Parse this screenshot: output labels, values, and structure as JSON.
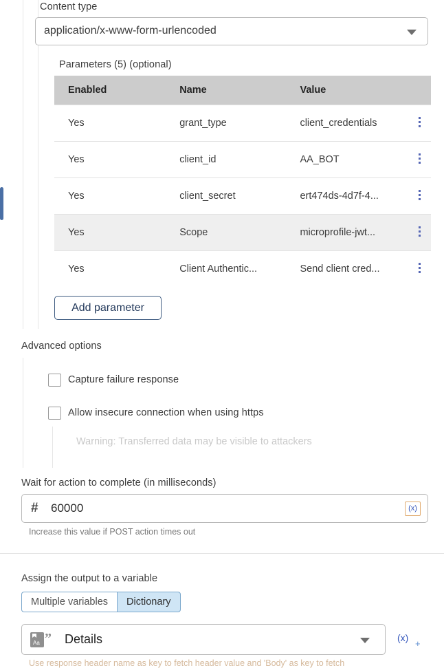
{
  "content_type": {
    "label": "Content type",
    "value": "application/x-www-form-urlencoded",
    "caret_icon": "chevron-down-icon"
  },
  "parameters": {
    "section_label": "Parameters (5) (optional)",
    "columns": [
      "Enabled",
      "Name",
      "Value"
    ],
    "rows": [
      {
        "enabled": "Yes",
        "name": "grant_type",
        "value": "client_credentials"
      },
      {
        "enabled": "Yes",
        "name": "client_id",
        "value": "AA_BOT"
      },
      {
        "enabled": "Yes",
        "name": "client_secret",
        "value": "ert474ds-4d7f-4..."
      },
      {
        "enabled": "Yes",
        "name": "Scope",
        "value": "microprofile-jwt..."
      },
      {
        "enabled": "Yes",
        "name": "Client Authentic...",
        "value": "Send client cred..."
      }
    ],
    "row_menu_icon": "kebab-menu-icon",
    "add_button_label": "Add parameter"
  },
  "advanced_options": {
    "label": "Advanced options",
    "capture_failure_label": "Capture failure response",
    "capture_failure_checked": false,
    "allow_insecure_label": "Allow insecure connection when using https",
    "allow_insecure_checked": false,
    "insecure_warning": "Warning: Transferred data may be visible to attackers"
  },
  "wait_for_action": {
    "label": "Wait for action to complete (in milliseconds)",
    "number_icon": "hash-icon",
    "value": "60000",
    "variable_button_label": "(x)",
    "help_text": "Increase this value if POST action times out"
  },
  "assign_output": {
    "label": "Assign the output to a variable",
    "toggle_options": [
      "Multiple variables",
      "Dictionary"
    ],
    "selected_toggle": "Dictionary",
    "dictionary_icon": "dictionary-icon",
    "dictionary_value": "Details",
    "caret_icon": "chevron-down-icon",
    "variable_button_label": "(x)",
    "variable_add_label": "+",
    "help_text": "Use response header name as key to fetch header value and 'Body' as key to fetch"
  }
}
